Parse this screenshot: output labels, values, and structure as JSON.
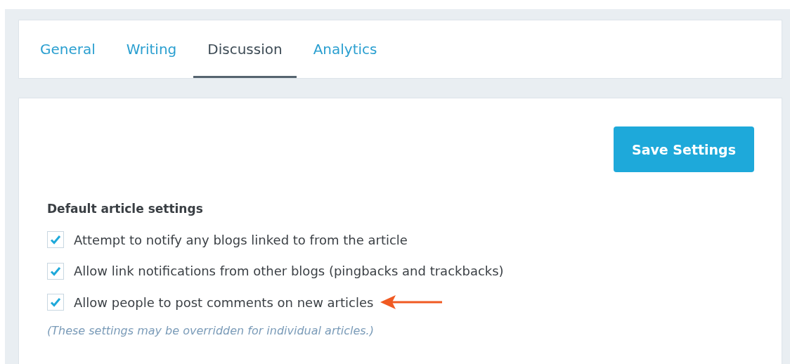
{
  "tabs": [
    {
      "label": "General",
      "selected": false
    },
    {
      "label": "Writing",
      "selected": false
    },
    {
      "label": "Discussion",
      "selected": true
    },
    {
      "label": "Analytics",
      "selected": false
    }
  ],
  "save_button": "Save Settings",
  "section": {
    "title": "Default article settings",
    "options": [
      {
        "label": "Attempt to notify any blogs linked to from the article",
        "checked": true,
        "annotated": false
      },
      {
        "label": "Allow link notifications from other blogs (pingbacks and trackbacks)",
        "checked": true,
        "annotated": false
      },
      {
        "label": "Allow people to post comments on new articles",
        "checked": true,
        "annotated": true
      }
    ],
    "note": "(These settings may be overridden for individual articles.)"
  }
}
